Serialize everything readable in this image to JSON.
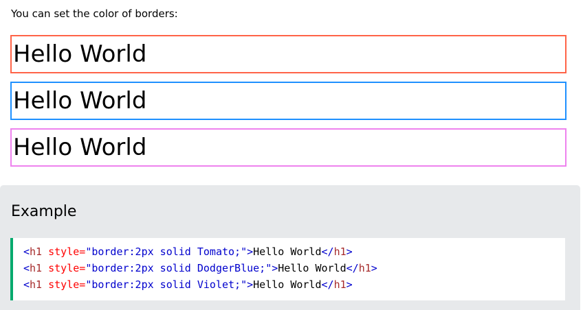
{
  "intro_text": "You can set the color of borders:",
  "demos": [
    {
      "text": "Hello World",
      "border_color": "#ff6347"
    },
    {
      "text": "Hello World",
      "border_color": "#1e90ff"
    },
    {
      "text": "Hello World",
      "border_color": "#ee82ee"
    }
  ],
  "example": {
    "title": "Example",
    "accent_color": "#04aa6d",
    "code_lines": [
      {
        "tag_open": "<",
        "tag": "h1",
        "attr": " style=",
        "value": "\"border:2px solid Tomato;\"",
        "close_open": ">",
        "text": "Hello World",
        "end_open": "</",
        "end_tag": "h1",
        "end_close": ">"
      },
      {
        "tag_open": "<",
        "tag": "h1",
        "attr": " style=",
        "value": "\"border:2px solid DodgerBlue;\"",
        "close_open": ">",
        "text": "Hello World",
        "end_open": "</",
        "end_tag": "h1",
        "end_close": ">"
      },
      {
        "tag_open": "<",
        "tag": "h1",
        "attr": " style=",
        "value": "\"border:2px solid Violet;\"",
        "close_open": ">",
        "text": "Hello World",
        "end_open": "</",
        "end_tag": "h1",
        "end_close": ">"
      }
    ]
  }
}
